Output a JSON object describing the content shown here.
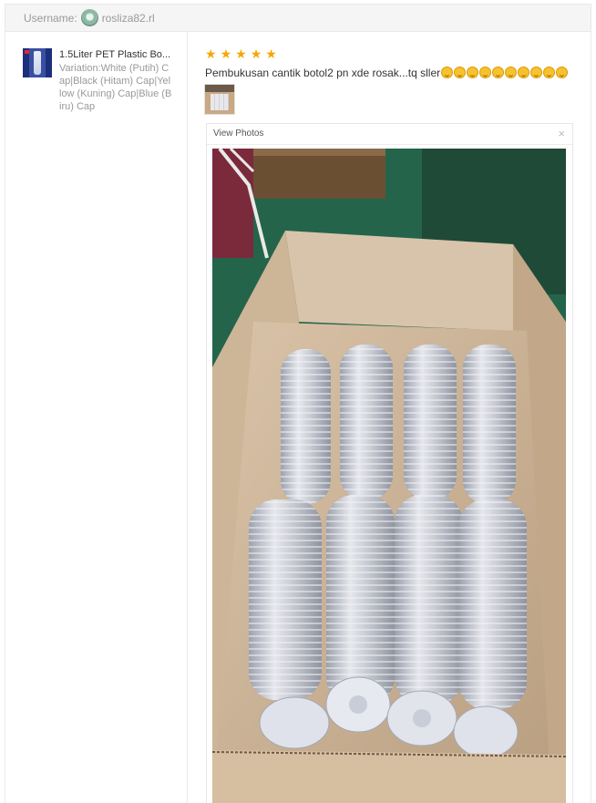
{
  "header": {
    "username_label": "Username:",
    "username": "rosliza82.rl"
  },
  "product": {
    "title": "1.5Liter PET Plastic Bo...",
    "variation": "Variation:White (Putih) Cap|Black (Hitam) Cap|Yellow (Kuning) Cap|Blue (Biru) Cap"
  },
  "review": {
    "rating": 5,
    "comment": "Pembukusan cantik botol2 pn xde rosak...tq sller",
    "emoji_count": 10
  },
  "viewer": {
    "title": "View Photos",
    "close_icon": "×"
  },
  "colors": {
    "star": "#f6a700",
    "muted_text": "#999999",
    "border": "#ebebeb"
  }
}
